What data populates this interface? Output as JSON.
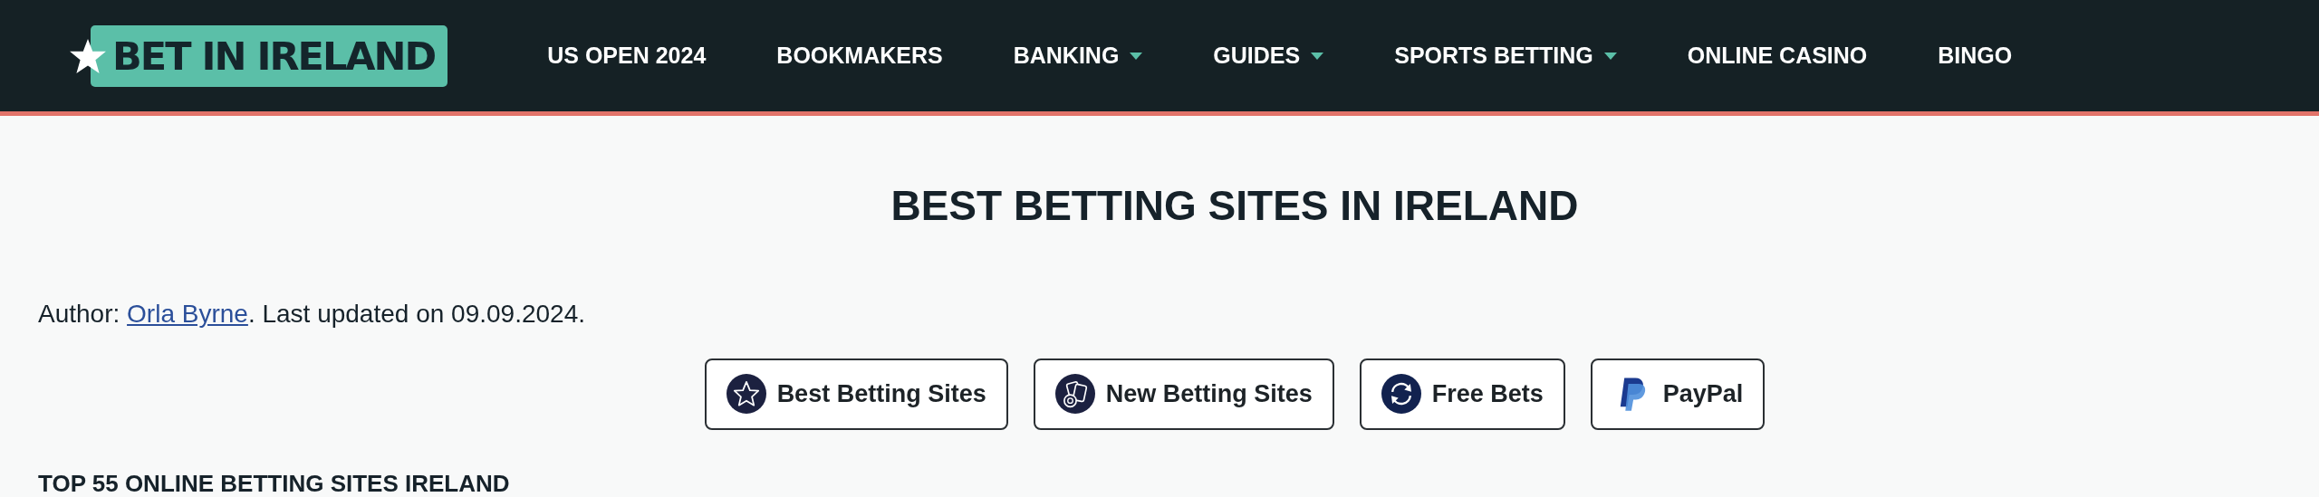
{
  "header": {
    "logo": {
      "text": "BET IN IRELAND"
    },
    "nav": [
      {
        "label": "US OPEN 2024",
        "has_dropdown": false
      },
      {
        "label": "BOOKMAKERS",
        "has_dropdown": false
      },
      {
        "label": "BANKING",
        "has_dropdown": true
      },
      {
        "label": "GUIDES",
        "has_dropdown": true
      },
      {
        "label": "SPORTS BETTING",
        "has_dropdown": true
      },
      {
        "label": "ONLINE CASINO",
        "has_dropdown": false
      },
      {
        "label": "BINGO",
        "has_dropdown": false
      }
    ]
  },
  "title": "BEST BETTING SITES IN IRELAND",
  "byline": {
    "prefix": "Author: ",
    "author": "Orla Byrne",
    "suffix": ". Last updated on 09.09.2024."
  },
  "quick_links": [
    {
      "label": "Best Betting Sites"
    },
    {
      "label": "New Betting Sites"
    },
    {
      "label": "Free Bets"
    },
    {
      "label": "PayPal"
    }
  ],
  "section_heading": "TOP 55 ONLINE BETTING SITES IRELAND"
}
